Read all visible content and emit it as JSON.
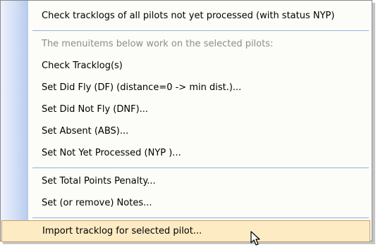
{
  "menu": {
    "items": [
      {
        "label": "Check tracklogs of all pilots not yet processed (with status NYP)",
        "enabled": true
      },
      {
        "label": "The menuitems below work on the selected pilots:",
        "enabled": false
      },
      {
        "label": "Check Tracklog(s)",
        "enabled": true
      },
      {
        "label": "Set Did Fly (DF) (distance=0 -> min dist.)...",
        "enabled": true
      },
      {
        "label": "Set Did Not Fly (DNF)...",
        "enabled": true
      },
      {
        "label": "Set Absent (ABS)...",
        "enabled": true
      },
      {
        "label": "Set Not Yet Processed (NYP )...",
        "enabled": true
      },
      {
        "label": "Set Total Points Penalty...",
        "enabled": true
      },
      {
        "label": "Set (or remove) Notes...",
        "enabled": true
      },
      {
        "label": "Import tracklog for selected pilot...",
        "enabled": true,
        "highlighted": true
      }
    ]
  },
  "colors": {
    "gutter": "#b7cbee",
    "background": "#fcfcf9",
    "highlight": "#fdebc4",
    "highlight_border": "#c7a26a",
    "disabled_text": "#8c8c8c",
    "separator": "#9bb0d8"
  },
  "cursor_icon": "arrow-pointer-icon"
}
